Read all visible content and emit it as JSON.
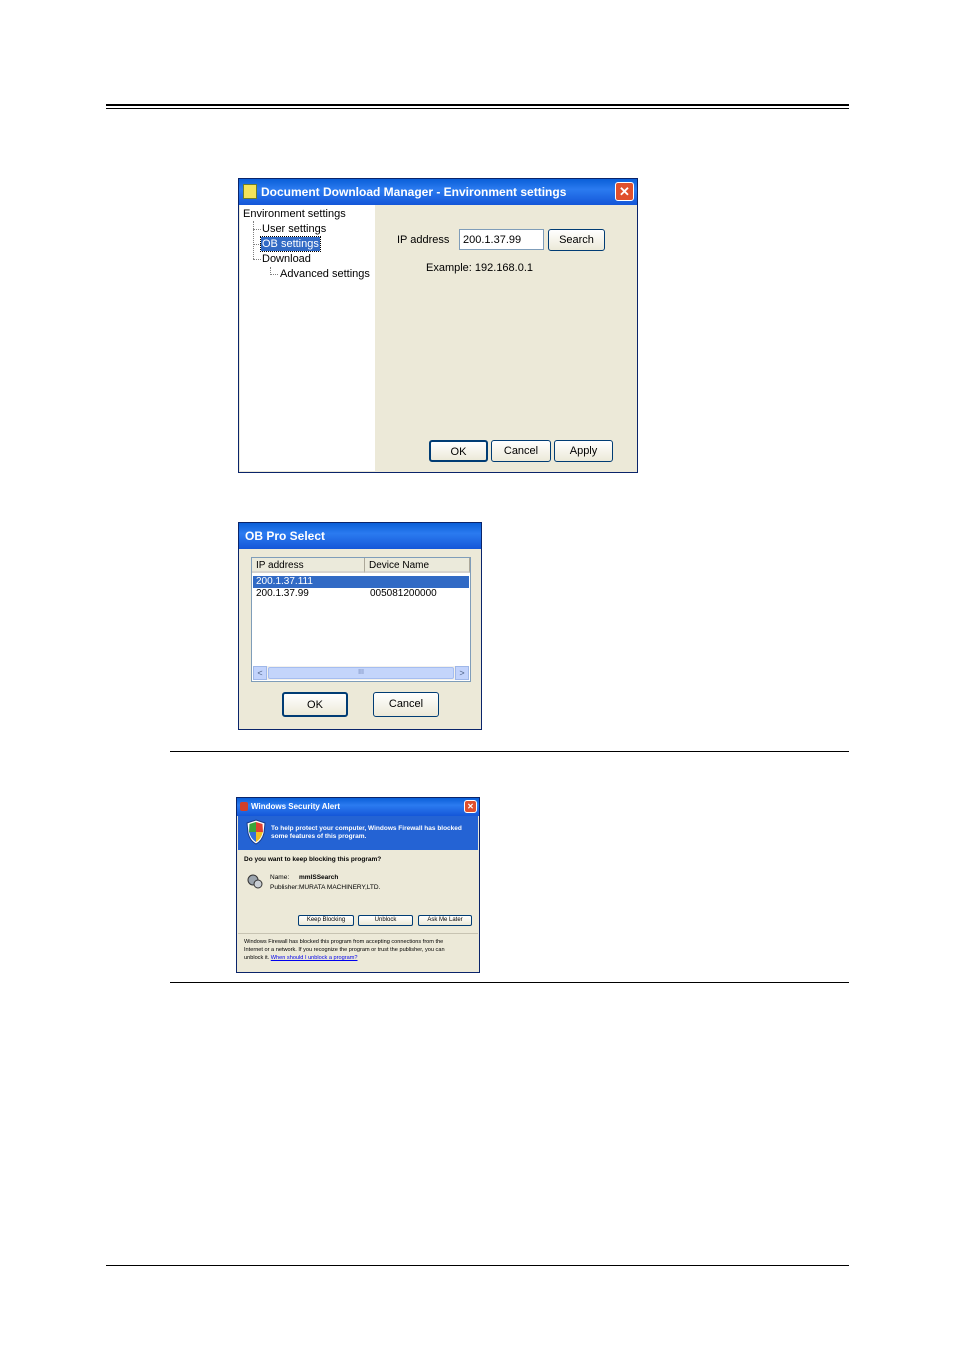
{
  "dialog_environment": {
    "title": "Document Download Manager - Environment settings",
    "close_glyph": "✕",
    "tree": {
      "root": "Environment settings",
      "items": [
        "User settings",
        "OB settings",
        "Download"
      ],
      "subitem": "Advanced settings",
      "selected": "OB settings"
    },
    "ip_label": "IP address",
    "ip_value": "200.1.37.99",
    "search_button": "Search",
    "example": "Example: 192.168.0.1",
    "ok_button": "OK",
    "cancel_button": "Cancel",
    "apply_button": "Apply"
  },
  "dialog_ob_select": {
    "title": "OB Pro Select",
    "columns": [
      "IP address",
      "Device Name"
    ],
    "rows": [
      {
        "ip": "200.1.37.111",
        "device": "",
        "selected": true
      },
      {
        "ip": "200.1.37.99",
        "device": "005081200000",
        "selected": false
      }
    ],
    "scroll_left": "<",
    "scroll_thumb": "III",
    "scroll_right": ">",
    "ok_button": "OK",
    "cancel_button": "Cancel"
  },
  "dialog_security_alert": {
    "title": "Windows Security Alert",
    "close_glyph": "✕",
    "banner_line1": "To help protect your computer, Windows Firewall has blocked",
    "banner_line2": "some features of this program.",
    "question": "Do you want to keep blocking this program?",
    "name_label": "Name:",
    "name_value": "mmlSSearch",
    "publisher_label": "Publisher:",
    "publisher_value": "MURATA MACHINERY,LTD.",
    "keep_blocking_button": "Keep Blocking",
    "unblock_button": "Unblock",
    "ask_later_button": "Ask Me Later",
    "footer_line1": "Windows Firewall has blocked this program from accepting connections from the",
    "footer_line2": "Internet or a network. If you recognize the program or trust the publisher, you can",
    "footer_line3": "unblock it.",
    "footer_link": "When should I unblock a program?"
  }
}
